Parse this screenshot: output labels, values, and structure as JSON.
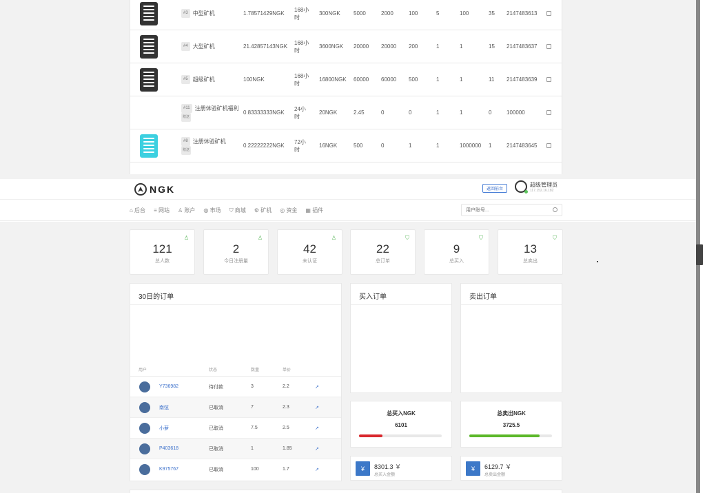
{
  "miners": [
    {
      "id": "#3",
      "name": "中型矿机",
      "price": "1.78571429NGK",
      "period": "168小\n时",
      "cost": "300NGK",
      "c1": "5000",
      "c2": "2000",
      "c3": "100",
      "c4": "5",
      "c5": "100",
      "c6": "35",
      "c7": "2147483613",
      "icon": "miner-dark",
      "tag": ""
    },
    {
      "id": "#4",
      "name": "大型矿机",
      "price": "21.42857143NGK",
      "period": "168小\n时",
      "cost": "3600NGK",
      "c1": "20000",
      "c2": "20000",
      "c3": "200",
      "c4": "1",
      "c5": "1",
      "c6": "15",
      "c7": "2147483637",
      "icon": "miner-dark",
      "tag": ""
    },
    {
      "id": "#5",
      "name": "超级矿机",
      "price": "100NGK",
      "period": "168小\n时",
      "cost": "16800NGK",
      "c1": "60000",
      "c2": "60000",
      "c3": "500",
      "c4": "1",
      "c5": "1",
      "c6": "11",
      "c7": "2147483639",
      "icon": "miner-dark",
      "tag": ""
    },
    {
      "id": "#11",
      "name": "注册体验矿机福利",
      "price": "0.83333333NGK",
      "period": "24小\n时",
      "cost": "20NGK",
      "c1": "2.45",
      "c2": "0",
      "c3": "0",
      "c4": "1",
      "c5": "1",
      "c6": "0",
      "c7": "100000",
      "icon": "",
      "tag": "赠送"
    },
    {
      "id": "#8",
      "name": "注册体验矿机",
      "price": "0.22222222NGK",
      "period": "72小\n时",
      "cost": "16NGK",
      "c1": "500",
      "c2": "0",
      "c3": "1",
      "c4": "1",
      "c5": "1000000",
      "c6": "1",
      "c7": "2147483645",
      "icon": "miner-cyan",
      "tag": "赠送"
    }
  ],
  "header": {
    "logo": "NGK",
    "back_button": "返回前台",
    "admin_name": "超级管理员",
    "admin_ip": "117.152.16.182"
  },
  "nav": [
    "⌂ 后台",
    "≡ 网站",
    "♙ 账户",
    "◍ 市场",
    "⛉ 商城",
    "⚙ 矿机",
    "◎ 资金",
    "▦ 插件"
  ],
  "search": {
    "placeholder": "用户账号..."
  },
  "stats": [
    {
      "num": "121",
      "label": "总人数",
      "icon": "user-icon"
    },
    {
      "num": "2",
      "label": "今日注册量",
      "icon": "user-icon"
    },
    {
      "num": "42",
      "label": "未认证",
      "icon": "user-icon"
    },
    {
      "num": "22",
      "label": "总订单",
      "icon": "cart-icon"
    },
    {
      "num": "9",
      "label": "总买入",
      "icon": "cart-icon"
    },
    {
      "num": "13",
      "label": "总卖出",
      "icon": "cart-icon"
    }
  ],
  "orders_panel": {
    "title": "30日的订单",
    "columns": [
      "用户",
      "状态",
      "数量",
      "单价"
    ],
    "rows": [
      {
        "user": "Y736982",
        "status": "待付款",
        "qty": "3",
        "price": "2.2"
      },
      {
        "user": "南弦",
        "status": "已取消",
        "qty": "7",
        "price": "2.3"
      },
      {
        "user": "小萝",
        "status": "已取消",
        "qty": "7.5",
        "price": "2.5"
      },
      {
        "user": "P403618",
        "status": "已取消",
        "qty": "1",
        "price": "1.85"
      },
      {
        "user": "K975767",
        "status": "已取消",
        "qty": "100",
        "price": "1.7"
      }
    ]
  },
  "buy_panel": {
    "title": "买入订单"
  },
  "sell_panel": {
    "title": "卖出订单"
  },
  "totals": {
    "buy": {
      "title": "总买入NGK",
      "value": "6101",
      "progress": 0.28,
      "color": "#d9282d"
    },
    "sell": {
      "title": "总卖出NGK",
      "value": "3725.5",
      "progress": 0.85,
      "color": "#5cb82a"
    }
  },
  "amounts": {
    "buy": {
      "symbol": "¥",
      "value": "8301.3 ￥",
      "label": "总买入金额"
    },
    "sell": {
      "symbol": "¥",
      "value": "6129.7 ￥",
      "label": "总卖出金额"
    }
  }
}
